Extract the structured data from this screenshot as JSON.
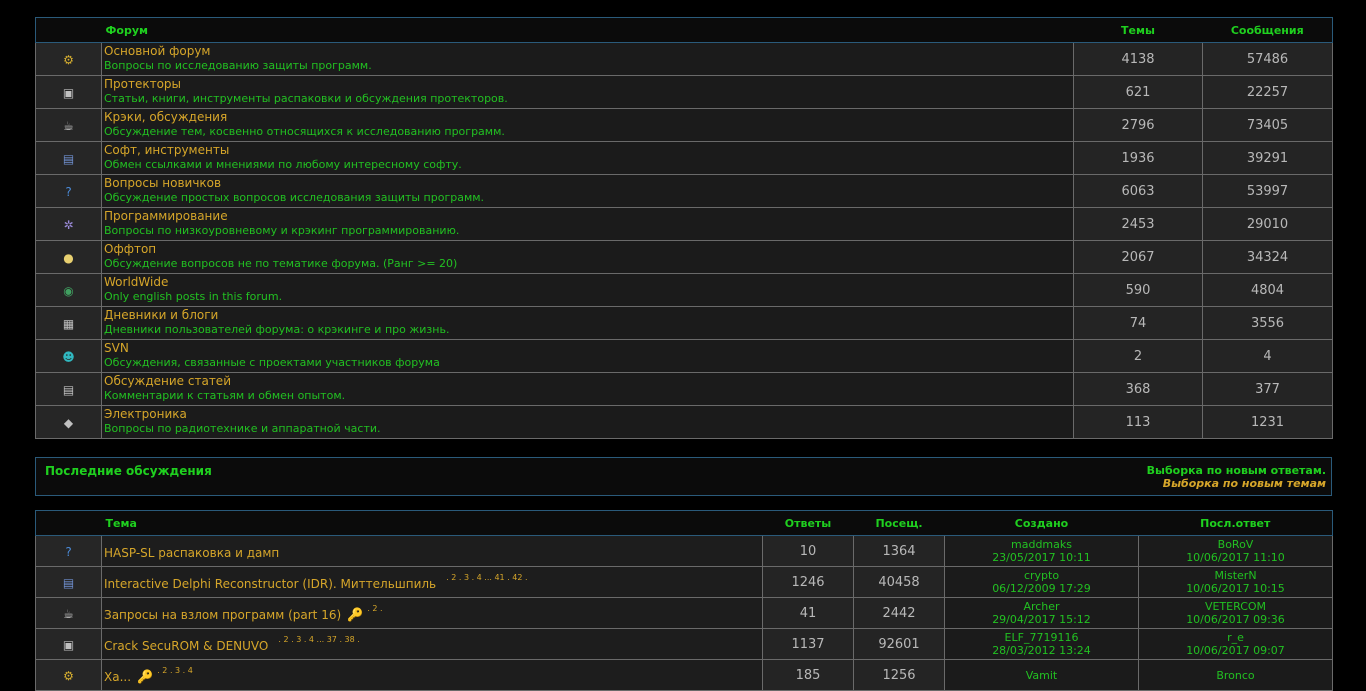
{
  "forums_header": {
    "forum": "Форум",
    "topics": "Темы",
    "posts": "Сообщения"
  },
  "forums": [
    {
      "icon": "gear-icon",
      "glyph": "⚙",
      "color": "#d8b030",
      "title": "Основной форум",
      "desc": "Вопросы по исследованию защиты программ.",
      "topics": "4138",
      "posts": "57486"
    },
    {
      "icon": "box-icon",
      "glyph": "▣",
      "color": "#c0c0c0",
      "title": "Протекторы",
      "desc": "Статьи, книги, инструменты распаковки и обсуждения протекторов.",
      "topics": "621",
      "posts": "22257"
    },
    {
      "icon": "cup-icon",
      "glyph": "☕",
      "color": "#d0d0d0",
      "title": "Крэки, обсуждения",
      "desc": "Обсуждение тем, косвенно относящихся к исследованию программ.",
      "topics": "2796",
      "posts": "73405"
    },
    {
      "icon": "window-icon",
      "glyph": "▤",
      "color": "#7090d0",
      "title": "Софт, инструменты",
      "desc": "Обмен ссылками и мнениями по любому интересному софту.",
      "topics": "1936",
      "posts": "39291"
    },
    {
      "icon": "question-icon",
      "glyph": "?",
      "color": "#4a8ad8",
      "title": "Вопросы новичков",
      "desc": "Обсуждение простых вопросов исследования защиты программ.",
      "topics": "6063",
      "posts": "53997"
    },
    {
      "icon": "cog-icon",
      "glyph": "✲",
      "color": "#9a8ad8",
      "title": "Программирование",
      "desc": "Вопросы по низкоуровневому и крэкинг программированию.",
      "topics": "2453",
      "posts": "29010"
    },
    {
      "icon": "bulb-icon",
      "glyph": "●",
      "color": "#e8d070",
      "title": "Оффтоп",
      "desc": "Обсуждение вопросов не по тематике форума. (Ранг >= 20)",
      "topics": "2067",
      "posts": "34324"
    },
    {
      "icon": "globe-icon",
      "glyph": "◉",
      "color": "#40a060",
      "title": "WorldWide",
      "desc": "Only english posts in this forum.",
      "topics": "590",
      "posts": "4804"
    },
    {
      "icon": "notepad-icon",
      "glyph": "▦",
      "color": "#c0c0c0",
      "title": "Дневники и блоги",
      "desc": "Дневники пользователей форума: о крэкинге и про жизнь.",
      "topics": "74",
      "posts": "3556"
    },
    {
      "icon": "alien-icon",
      "glyph": "☻",
      "color": "#30b8c0",
      "title": "SVN",
      "desc": "Обсуждения, связанные с проектами участников форума",
      "topics": "2",
      "posts": "4"
    },
    {
      "icon": "document-icon",
      "glyph": "▤",
      "color": "#c0c0c0",
      "title": "Обсуждение статей",
      "desc": "Комментарии к статьям и обмен опытом.",
      "topics": "368",
      "posts": "377"
    },
    {
      "icon": "chip-icon",
      "glyph": "◆",
      "color": "#c0c0c0",
      "title": "Электроника",
      "desc": "Вопросы по радиотехнике и аппаратной части.",
      "topics": "113",
      "posts": "1231"
    }
  ],
  "recent": {
    "title": "Последние обсуждения",
    "by_answers": "Выборка по новым ответам.",
    "by_topics": "Выборка по новым темам"
  },
  "topics_header": {
    "topic": "Тема",
    "replies": "Ответы",
    "views": "Посещ.",
    "created": "Создано",
    "last": "Посл.ответ"
  },
  "topics": [
    {
      "icon": "question-icon",
      "glyph": "?",
      "color": "#4a8ad8",
      "title": "HASP-SL распаковка и дамп",
      "pages": "",
      "key": "",
      "replies": "10",
      "views": "1364",
      "creator": "maddmaks",
      "created": "23/05/2017 10:11",
      "last_user": "BoRoV",
      "last_date": "10/06/2017 11:10"
    },
    {
      "icon": "window-icon",
      "glyph": "▤",
      "color": "#7090d0",
      "title": "Interactive Delphi Reconstructor (IDR). Миттельшпиль",
      "pages": ". 2 . 3 . 4 ... 41 . 42 .",
      "key": "",
      "replies": "1246",
      "views": "40458",
      "creator": "crypto",
      "created": "06/12/2009 17:29",
      "last_user": "MisterN",
      "last_date": "10/06/2017 10:15"
    },
    {
      "icon": "cup-icon",
      "glyph": "☕",
      "color": "#d0d0d0",
      "title": "Запросы на взлом программ (part 16)",
      "pages": ". 2 .",
      "key": "🔑",
      "replies": "41",
      "views": "2442",
      "creator": "Archer",
      "created": "29/04/2017 15:12",
      "last_user": "VETERCOM",
      "last_date": "10/06/2017 09:36"
    },
    {
      "icon": "box-icon",
      "glyph": "▣",
      "color": "#c0c0c0",
      "title": "Crack SecuROM & DENUVO",
      "pages": ". 2 . 3 . 4 ... 37 . 38 .",
      "key": "",
      "replies": "1137",
      "views": "92601",
      "creator": "ELF_7719116",
      "created": "28/03/2012 13:24",
      "last_user": "r_e",
      "last_date": "10/06/2017 09:07"
    },
    {
      "icon": "gear-icon",
      "glyph": "⚙",
      "color": "#d8b030",
      "title": "Ха...",
      "pages": ". 2 . 3 . 4",
      "key": "🔑",
      "replies": "185",
      "views": "1256",
      "creator": "Vamit",
      "created": "",
      "last_user": "Bronco",
      "last_date": ""
    }
  ]
}
